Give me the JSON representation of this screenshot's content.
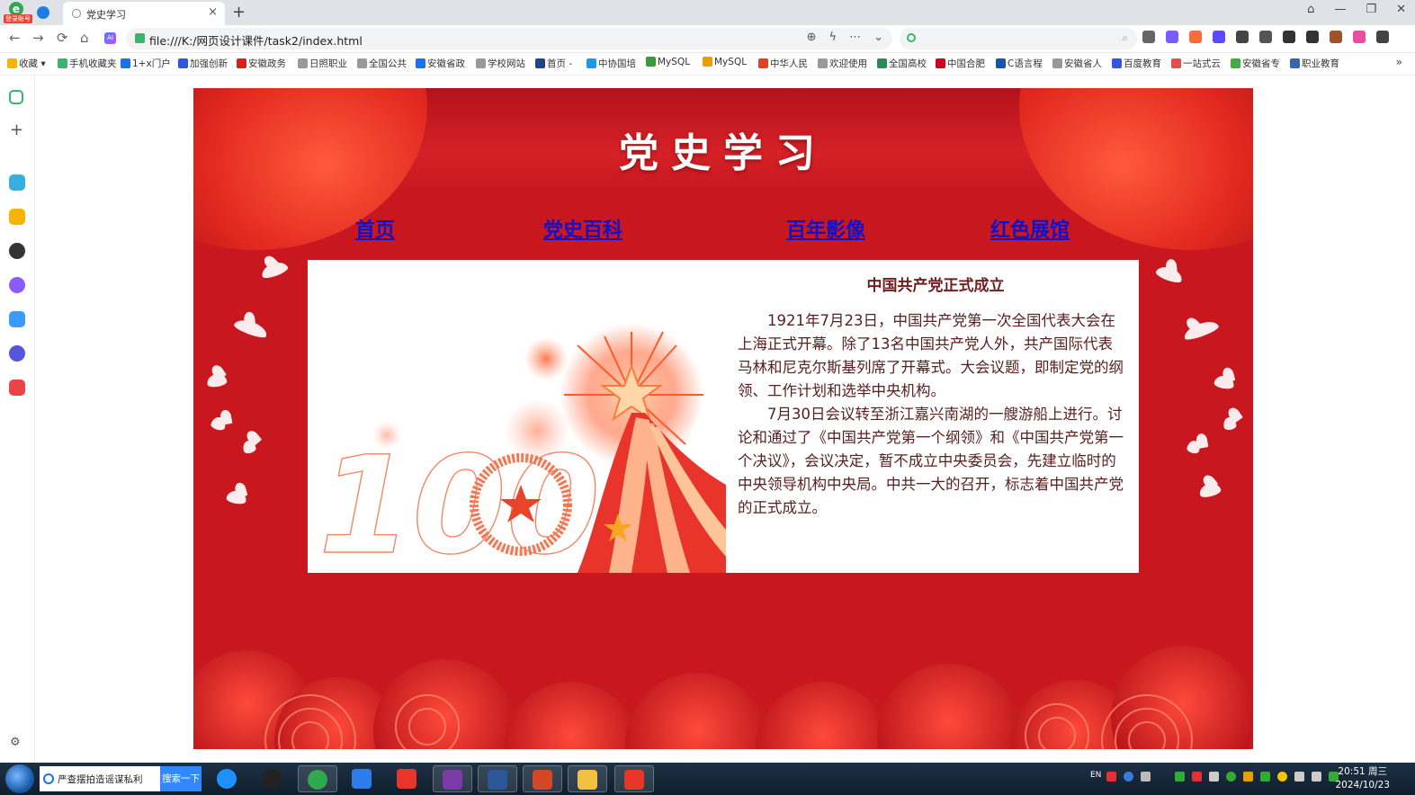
{
  "browser": {
    "badge": "登录账号",
    "tab_title": "党史学习",
    "tab_close": "×",
    "new_tab": "+",
    "url": "file:///K:/网页设计课件/task2/index.html",
    "window_buttons": [
      "⌂",
      "—",
      "❐",
      "✕"
    ],
    "nav_icons": [
      "←",
      "→",
      "⟳",
      "⌂"
    ],
    "bookmarks": [
      "收藏",
      "手机收藏夹",
      "1+x门户",
      "加强创新",
      "安徽政务",
      "日照职业",
      "全国公共",
      "安徽省政",
      "学校网站",
      "首页 -",
      "中协国培",
      "MySQL",
      "MySQL",
      "中华人民",
      "欢迎使用",
      "全国高校",
      "中国合肥",
      "C语言程",
      "安徽省人",
      "百度教育",
      "一站式云",
      "安徽省专",
      "职业教育"
    ],
    "bookmarks_more": "»"
  },
  "page": {
    "title": "党史学习",
    "nav": [
      "首页",
      "党史百科",
      "百年影像",
      "红色展馆"
    ],
    "article": {
      "title": "中国共产党正式成立",
      "p1": "1921年7月23日，中国共产党第一次全国代表大会在上海正式开幕。除了13名中国共产党人外，共产国际代表马林和尼克尔斯基列席了开幕式。大会议题，即制定党的纲领、工作计划和选举中央机构。",
      "p2": "7月30日会议转至浙江嘉兴南湖的一艘游船上进行。讨论和通过了《中国共产党第一个纲领》和《中国共产党第一个决议》，会议决定，暂不成立中央委员会，先建立临时的中央领导机构中央局。中共一大的召开，标志着中国共产党的正式成立。"
    },
    "graphic_text": "100"
  },
  "taskbar": {
    "search_text": "严查摆拍造谣谋私利",
    "search_button": "搜索一下",
    "lang": "EN",
    "time": "20:51 周三",
    "date": "2024/10/23"
  },
  "colors": {
    "page_red": "#c8171f",
    "nav_link": "#1111cc",
    "article_text": "#5a2020"
  }
}
